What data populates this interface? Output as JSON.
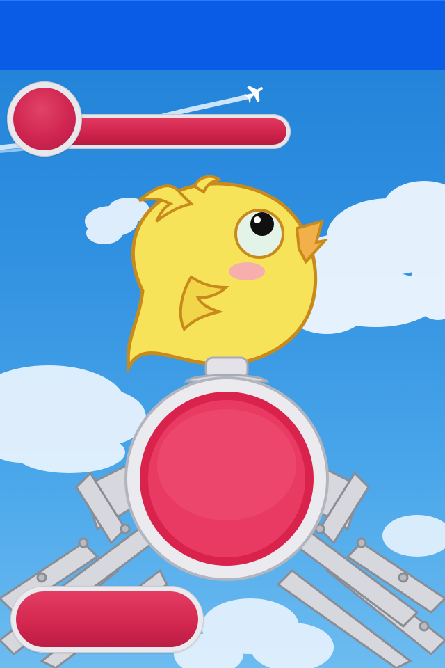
{
  "game": {
    "scene": "sky",
    "character": "yellow-chick"
  },
  "hud": {
    "power_slider": {
      "level": 0.0
    },
    "jump_button": {
      "icon": "red-circle-button"
    },
    "bottom_button": {
      "icon": "red-pill-button"
    }
  },
  "colors": {
    "header_blue": "#0a5ce6",
    "sky_top": "#1f7fd6",
    "sky_bottom": "#6dbcf0",
    "button_red": "#d2264f",
    "button_rim": "#e8e8ec",
    "chick_yellow": "#f6e35a",
    "chick_outline": "#c98a1c"
  }
}
